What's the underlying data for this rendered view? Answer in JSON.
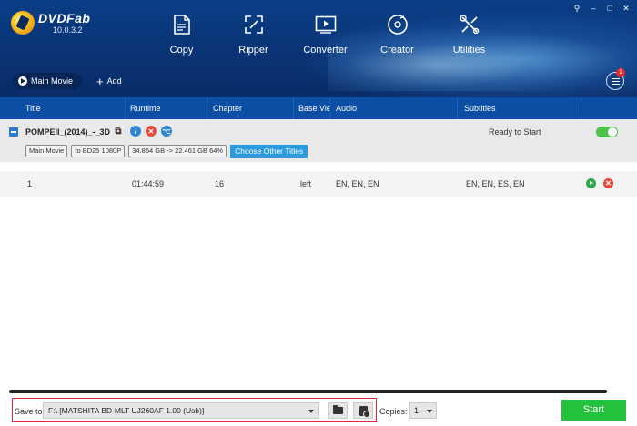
{
  "app": {
    "name": "DVDFab",
    "version": "10.0.3.2"
  },
  "nav": [
    {
      "label": "Copy",
      "icon": "copy-icon"
    },
    {
      "label": "Ripper",
      "icon": "ripper-icon"
    },
    {
      "label": "Converter",
      "icon": "converter-icon"
    },
    {
      "label": "Creator",
      "icon": "creator-icon"
    },
    {
      "label": "Utilities",
      "icon": "utilities-icon"
    }
  ],
  "window_controls": {
    "pin": "⚲",
    "minimize": "–",
    "maximize": "□",
    "close": "✕"
  },
  "tabs": {
    "main_movie": "Main Movie",
    "add": "Add"
  },
  "notification_count": "1",
  "columns": {
    "title": "Title",
    "runtime": "Runtime",
    "chapter": "Chapter",
    "base_view": "Base View",
    "audio": "Audio",
    "subtitles": "Subtitles"
  },
  "title_item": {
    "name": "POMPEII_(2014)_-_3D",
    "status": "Ready to Start",
    "chips": [
      "Main Movie",
      "to BD25 1080P",
      "34.854 GB -> 22.461 GB 64%"
    ],
    "other_titles_label": "Choose Other Titles",
    "enabled": true
  },
  "rows": [
    {
      "title": "1",
      "runtime": "01:44:59",
      "chapter": "16",
      "base_view": "left",
      "audio": "EN, EN, EN",
      "subtitles": "EN, EN, ES, EN"
    }
  ],
  "bottom": {
    "save_to_label": "Save to:",
    "save_path": "F:\\ [MATSHITA BD-MLT UJ260AF 1.00 (Usb)]",
    "copies_label": "Copies:",
    "copies_value": "1",
    "start_label": "Start"
  },
  "colors": {
    "header": "#0b3e86",
    "column_header": "#0c4ea4",
    "start": "#22c33a",
    "highlight_box": "#e0283a",
    "accent": "#2a9be0"
  }
}
